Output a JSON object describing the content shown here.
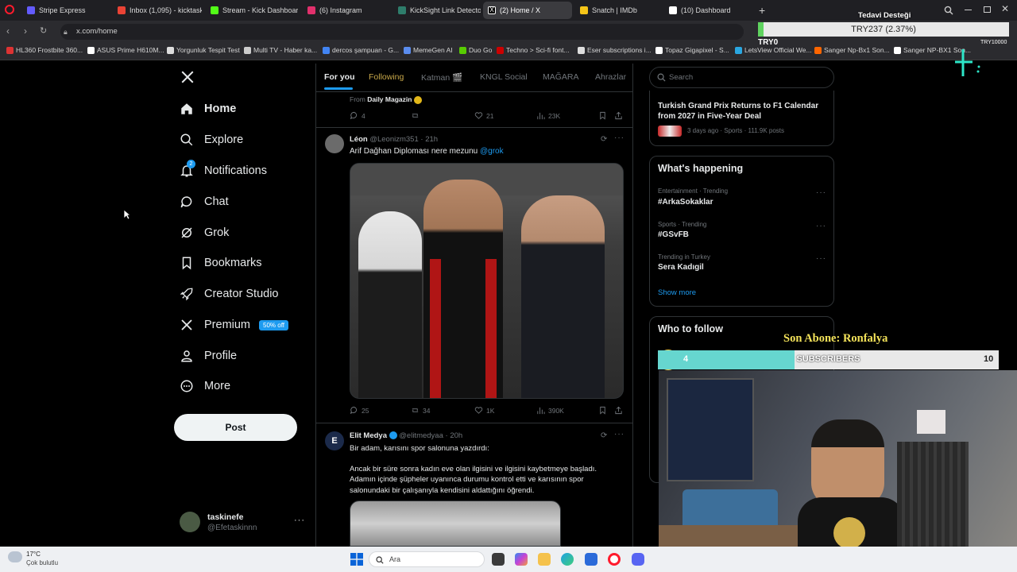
{
  "browser": {
    "tabs": [
      {
        "label": "Stripe Express",
        "color": "#635bff"
      },
      {
        "label": "Inbox (1,095) - kicktaskine",
        "color": "#ea4335"
      },
      {
        "label": "Stream - Kick Dashboard",
        "color": "#53fc18"
      },
      {
        "label": "(6) Instagram",
        "color": "#e1306c"
      },
      {
        "label": "KickSight Link Detector",
        "color": "#2e7d6b"
      },
      {
        "label": "(2) Home / X",
        "color": "#ffffff"
      },
      {
        "label": "Snatch | IMDb",
        "color": "#f5c518"
      },
      {
        "label": "(10) Dashboard",
        "color": "#ffffff"
      }
    ],
    "url": "x.com/home",
    "bookmarks": [
      "HL360 Frostbite 360...",
      "ASUS Prime H610M...",
      "Yorgunluk Tespit Test",
      "Multi TV - Haber ka...",
      "dercos şampuan - G...",
      "MemeGen AI",
      "Duo Go",
      "Techno > Sci-fi font...",
      "Eser subscriptions i...",
      "Topaz Gigapixel - S...",
      "LetsView Official We...",
      "Sanger Np-Bx1 Son...",
      "Sanger NP-BX1 Son..."
    ]
  },
  "nav": {
    "items": [
      {
        "label": "Home",
        "icon": "home-icon"
      },
      {
        "label": "Explore",
        "icon": "search-icon"
      },
      {
        "label": "Notifications",
        "icon": "bell-icon",
        "badge": "2"
      },
      {
        "label": "Chat",
        "icon": "chat-icon"
      },
      {
        "label": "Grok",
        "icon": "grok-icon"
      },
      {
        "label": "Bookmarks",
        "icon": "bookmark-icon"
      },
      {
        "label": "Creator Studio",
        "icon": "rocket-icon"
      },
      {
        "label": "Premium",
        "icon": "x-logo-icon"
      },
      {
        "label": "Profile",
        "icon": "person-icon"
      },
      {
        "label": "More",
        "icon": "more-circle-icon"
      }
    ],
    "premium_badge": "50% off",
    "post_label": "Post",
    "account": {
      "name": "taskinefe",
      "handle": "@Efetaskinnn"
    }
  },
  "feed": {
    "tabs": [
      "For you",
      "Following",
      "Katman 🎬",
      "KNGL Social",
      "MAĞARA",
      "Ahrazlar"
    ],
    "prev_post": {
      "from_label": "From",
      "from_name": "Daily Magazin",
      "replies": "4",
      "likes": "21",
      "views": "23K"
    },
    "post1": {
      "name": "Léon",
      "handle": "@Leonizm351",
      "time": "21h",
      "text": "Arif Dağhan Diploması  nere mezunu",
      "mention": "@grok",
      "replies": "25",
      "reposts": "34",
      "likes": "1K",
      "views": "390K"
    },
    "post2": {
      "name": "Elit Medya",
      "handle": "@elitmedyaa",
      "time": "20h",
      "line1": "Bir adam, karısını spor salonuna yazdırdı:",
      "line2": "Ancak bir süre sonra kadın eve olan ilgisini ve ilgisini kaybetmeye başladı. Adamın içinde şüpheler uyanınca durumu kontrol etti ve karısının spor salonundaki bir çalışanıyla kendisini aldattığını öğrendi."
    }
  },
  "sidebar": {
    "search_placeholder": "Search",
    "top_story": {
      "title": "Turkish Grand Prix Returns to F1 Calendar from 2027 in Five-Year Deal",
      "meta": "3 days ago · Sports · 111.9K posts"
    },
    "happening_title": "What's happening",
    "trends": [
      {
        "meta": "Entertainment · Trending",
        "title": "#ArkaSokaklar"
      },
      {
        "meta": "Sports · Trending",
        "title": "#GSvFB"
      },
      {
        "meta": "Trending in Turkey",
        "title": "Sera Kadıgil"
      }
    ],
    "show_more": "Show more",
    "who_to_follow": "Who to follow"
  },
  "overlay": {
    "donation_title": "Tedavi Desteği",
    "donation_amount": "TRY237 (2.37%)",
    "donation_min": "TRY0",
    "donation_max": "TRY10000",
    "donation_progress": 0.0237,
    "last_sub": "Son Abone: Ronfalya",
    "subs_current": "4",
    "subs_label": "SUBSCRIBERS",
    "subs_goal": "10",
    "subs_progress": 0.4
  },
  "taskbar": {
    "weather_temp": "17°C",
    "weather_desc": "Çok bulutlu",
    "search_label": "Ara"
  }
}
